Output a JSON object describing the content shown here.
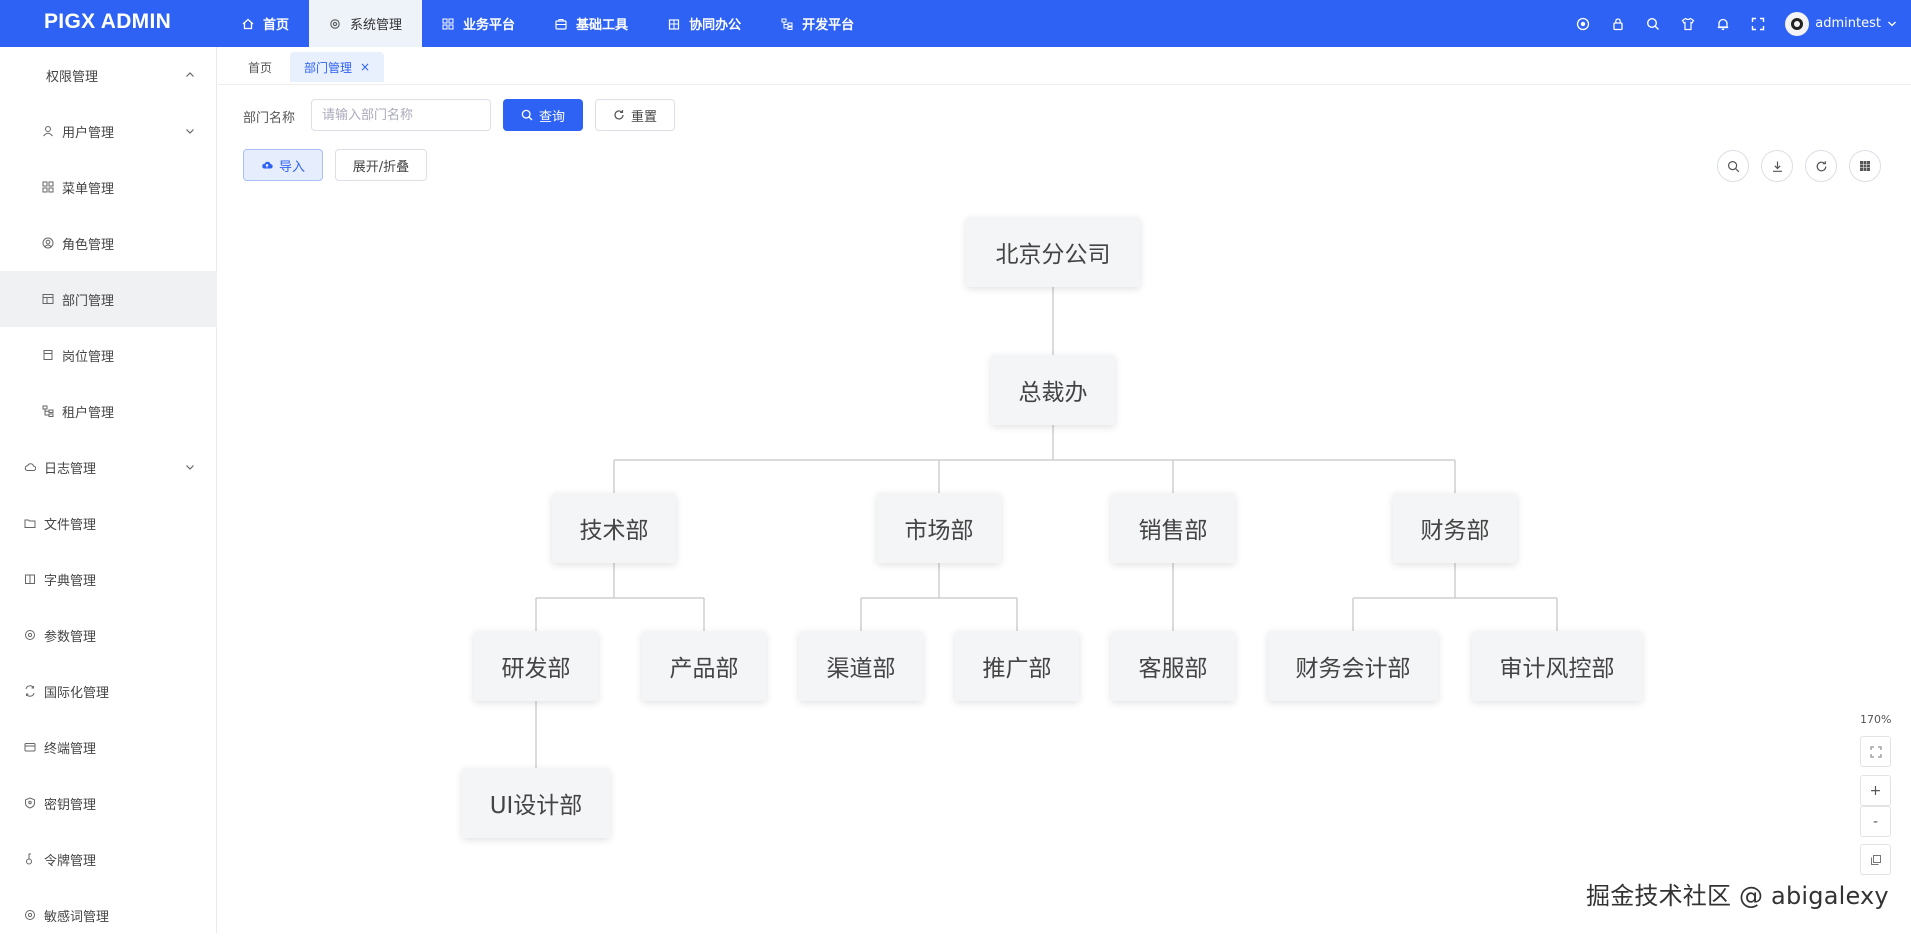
{
  "app": {
    "logo": "PIGX ADMIN",
    "top_nav": [
      {
        "label": "首页",
        "icon": "home-icon"
      },
      {
        "label": "系统管理",
        "icon": "gear-icon",
        "active": true
      },
      {
        "label": "业务平台",
        "icon": "grid-icon"
      },
      {
        "label": "基础工具",
        "icon": "toolbox-icon"
      },
      {
        "label": "协同办公",
        "icon": "building-icon"
      },
      {
        "label": "开发平台",
        "icon": "tree-icon"
      }
    ],
    "user": {
      "name": "admintest"
    },
    "accent": "#2e62f5"
  },
  "sidebar": {
    "items": [
      {
        "label": "权限管理",
        "level": 0,
        "arrow": "up"
      },
      {
        "label": "用户管理",
        "level": 1,
        "arrow": "down",
        "icon": "user-icon"
      },
      {
        "label": "菜单管理",
        "level": 1,
        "icon": "grid-icon"
      },
      {
        "label": "角色管理",
        "level": 1,
        "icon": "user-circle-icon"
      },
      {
        "label": "部门管理",
        "level": 1,
        "icon": "department-icon",
        "active": true
      },
      {
        "label": "岗位管理",
        "level": 1,
        "icon": "post-icon"
      },
      {
        "label": "租户管理",
        "level": 1,
        "icon": "tree-icon"
      },
      {
        "label": "日志管理",
        "level": 0,
        "arrow": "down",
        "icon": "cloud-icon"
      },
      {
        "label": "文件管理",
        "level": 0,
        "icon": "folder-icon"
      },
      {
        "label": "字典管理",
        "level": 0,
        "icon": "book-icon"
      },
      {
        "label": "参数管理",
        "level": 0,
        "icon": "gear-icon"
      },
      {
        "label": "国际化管理",
        "level": 0,
        "icon": "translate-icon"
      },
      {
        "label": "终端管理",
        "level": 0,
        "icon": "terminal-icon"
      },
      {
        "label": "密钥管理",
        "level": 0,
        "icon": "shield-icon"
      },
      {
        "label": "令牌管理",
        "level": 0,
        "icon": "token-icon"
      },
      {
        "label": "敏感词管理",
        "level": 0,
        "icon": "filter-icon"
      }
    ]
  },
  "tabs": [
    {
      "label": "首页"
    },
    {
      "label": "部门管理",
      "active": true,
      "close": "×"
    }
  ],
  "search": {
    "dept_label": "部门名称",
    "dept_placeholder": "请输入部门名称",
    "query_label": "查询",
    "reset_label": "重置"
  },
  "toolbar": {
    "import_label": "导入",
    "expand_label": "展开/折叠"
  },
  "org_chart": {
    "root": "北京分公司",
    "level1": "总裁办",
    "level2": [
      "技术部",
      "市场部",
      "销售部",
      "财务部"
    ],
    "level3": [
      "研发部",
      "产品部",
      "渠道部",
      "推广部",
      "客服部",
      "财务会计部",
      "审计风控部"
    ],
    "level4": [
      "UI设计部"
    ]
  },
  "zoom": {
    "level": "170%",
    "plus": "+",
    "minus": "-"
  },
  "credit": "掘金技术社区 @ abigalexy"
}
